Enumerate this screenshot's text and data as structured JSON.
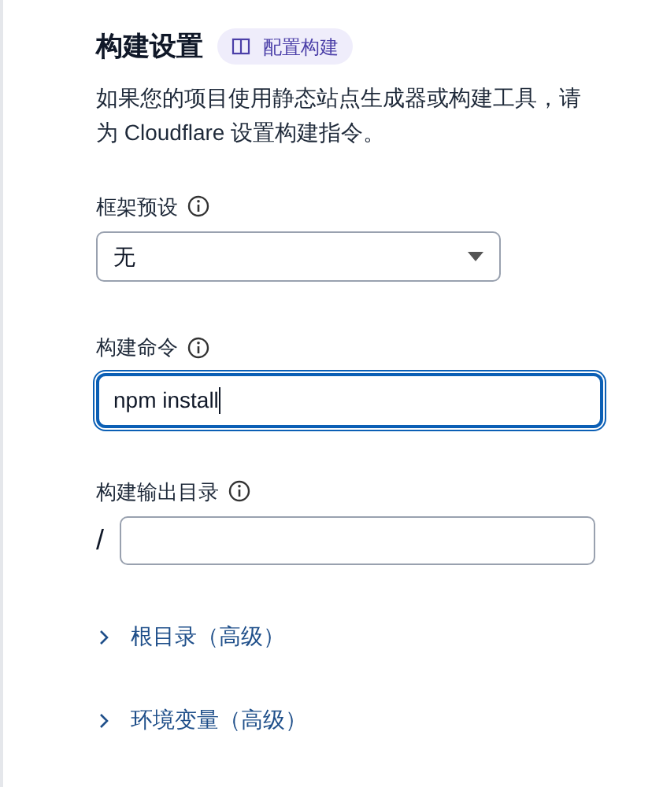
{
  "section": {
    "title": "构建设置",
    "badge": "配置构建",
    "description": "如果您的项目使用静态站点生成器或构建工具，请为 Cloudflare 设置构建指令。"
  },
  "fields": [
    {
      "kind": "select",
      "label": "框架预设",
      "value": "无",
      "focused": false
    },
    {
      "kind": "input",
      "label": "构建命令",
      "value": "npm install",
      "focused": true
    },
    {
      "kind": "prefixed",
      "label": "构建输出目录",
      "prefix": "/",
      "focused": false
    }
  ],
  "expanders": [
    {
      "label": "根目录（高级）",
      "expanded": false
    },
    {
      "label": "环境变量（高级）",
      "expanded": false
    }
  ]
}
